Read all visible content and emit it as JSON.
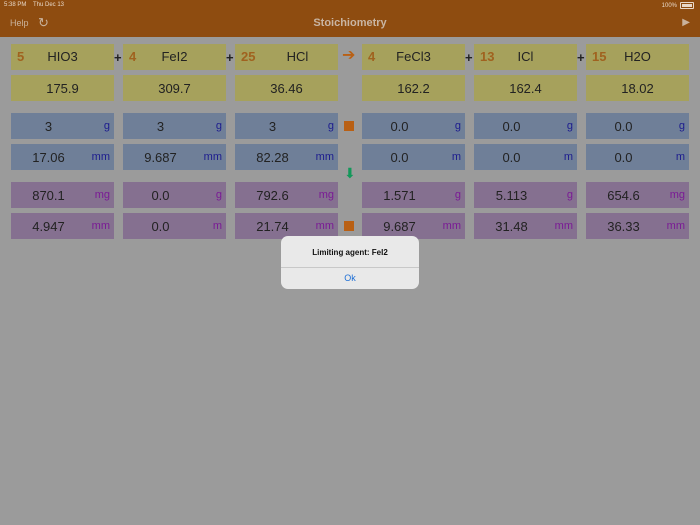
{
  "status_bar": {
    "time": "5:38 PM",
    "date": "Thu Dec 13",
    "battery": "100%"
  },
  "nav": {
    "help": "Help",
    "title": "Stoichiometry"
  },
  "equation": [
    {
      "coef": "5",
      "formula": "HIO3"
    },
    {
      "coef": "4",
      "formula": "FeI2"
    },
    {
      "coef": "25",
      "formula": "HCl"
    },
    {
      "coef": "4",
      "formula": "FeCl3"
    },
    {
      "coef": "13",
      "formula": "ICl"
    },
    {
      "coef": "15",
      "formula": "H2O"
    }
  ],
  "plus_sign": "+",
  "molar_mass": [
    "175.9",
    "309.7",
    "36.46",
    "162.2",
    "162.4",
    "18.02"
  ],
  "input_mass": [
    {
      "value": "3",
      "unit": "g"
    },
    {
      "value": "3",
      "unit": "g"
    },
    {
      "value": "3",
      "unit": "g"
    },
    {
      "value": "0.0",
      "unit": "g"
    },
    {
      "value": "0.0",
      "unit": "g"
    },
    {
      "value": "0.0",
      "unit": "g"
    }
  ],
  "input_moles": [
    {
      "value": "17.06",
      "unit": "mm"
    },
    {
      "value": "9.687",
      "unit": "mm"
    },
    {
      "value": "82.28",
      "unit": "mm"
    },
    {
      "value": "0.0",
      "unit": "m"
    },
    {
      "value": "0.0",
      "unit": "m"
    },
    {
      "value": "0.0",
      "unit": "m"
    }
  ],
  "result_mass": [
    {
      "value": "870.1",
      "unit": "mg"
    },
    {
      "value": "0.0",
      "unit": "g"
    },
    {
      "value": "792.6",
      "unit": "mg"
    },
    {
      "value": "1.571",
      "unit": "g"
    },
    {
      "value": "5.113",
      "unit": "g"
    },
    {
      "value": "654.6",
      "unit": "mg"
    }
  ],
  "result_moles": [
    {
      "value": "4.947",
      "unit": "mm"
    },
    {
      "value": "0.0",
      "unit": "m"
    },
    {
      "value": "21.74",
      "unit": "mm"
    },
    {
      "value": "9.687",
      "unit": "mm"
    },
    {
      "value": "31.48",
      "unit": "mm"
    },
    {
      "value": "36.33",
      "unit": "mm"
    }
  ],
  "alert": {
    "message": "Limiting agent: FeI2",
    "button": "Ok"
  },
  "colors": {
    "bar": "#8e4c10",
    "accent": "#b96014",
    "arrow_down": "#13985a",
    "ok_button": "#1d6fd6"
  }
}
